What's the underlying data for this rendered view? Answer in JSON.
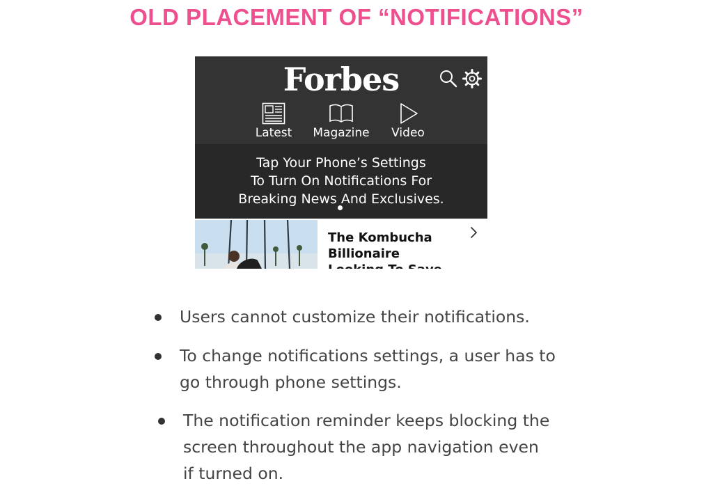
{
  "heading": "OLD PLACEMENT OF “NOTIFICATIONS”",
  "app": {
    "logo": "Forbes",
    "nav": [
      {
        "label": "Latest",
        "icon": "newspaper-icon"
      },
      {
        "label": "Magazine",
        "icon": "open-book-icon"
      },
      {
        "label": "Video",
        "icon": "play-icon"
      }
    ],
    "header_icons": [
      "search-icon",
      "gear-icon"
    ],
    "banner": {
      "line1": "Tap Your Phone’s Settings",
      "line2": "To Turn On Notifications For",
      "line3": "Breaking News And Exclusives."
    },
    "article": {
      "title_line1": "The Kombucha",
      "title_line2": "Billionaire",
      "title_line3": "Looking To Save"
    },
    "colors": {
      "header_bg": "#333333",
      "banner_bg": "#282828",
      "heading_pink": "#ee4f8f"
    }
  },
  "bullets": [
    {
      "lines": [
        "Users cannot customize their notifications."
      ]
    },
    {
      "lines": [
        "To change notifications settings, a user has to",
        "go through phone settings."
      ]
    },
    {
      "lines": [
        "The notification reminder keeps blocking the",
        "screen throughout the app navigation even",
        "if turned on."
      ]
    }
  ]
}
